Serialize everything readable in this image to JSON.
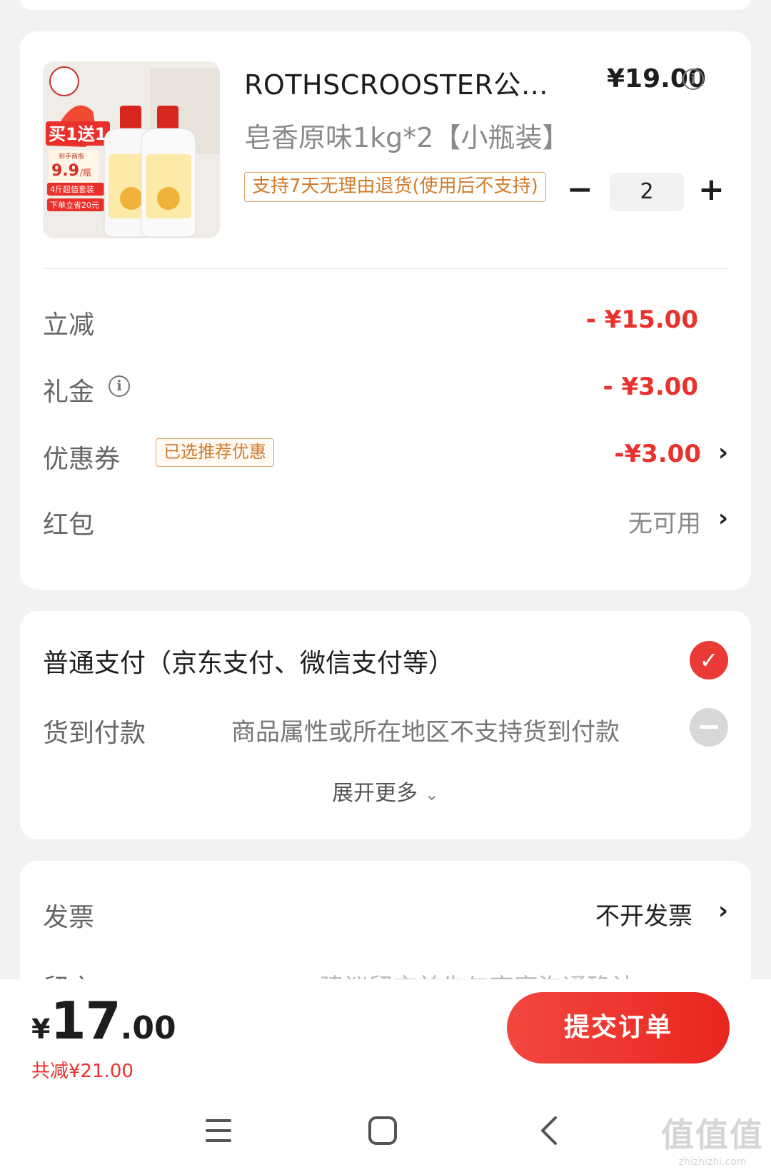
{
  "product": {
    "title": "ROTHSCROOSTER公鸡…",
    "price": "¥19.00",
    "spec": "皂香原味1kg*2【小瓶装】",
    "return_tag": "支持7天无理由退货(使用后不支持)",
    "quantity": "2",
    "image_text": {
      "promo": "买1送1",
      "sub": "到手两瓶",
      "price": "9.9",
      "unit": "/瓶",
      "line1": "4斤超值套装",
      "line2": "下单立省20元"
    }
  },
  "discounts": {
    "instant": {
      "label": "立减",
      "value": "- ¥15.00"
    },
    "gift": {
      "label": "礼金",
      "value": "- ¥3.00"
    },
    "coupon": {
      "label": "优惠券",
      "badge": "已选推荐优惠",
      "value": "-¥3.00"
    },
    "redpacket": {
      "label": "红包",
      "value": "无可用"
    }
  },
  "payment": {
    "normal_label": "普通支付（京东支付、微信支付等）",
    "cod_label": "货到付款",
    "cod_note": "商品属性或所在地区不支持货到付款",
    "expand_label": "展开更多"
  },
  "invoice": {
    "label": "发票",
    "value": "不开发票",
    "remark_label": "留言",
    "remark_hint": "建议留言前先与商家沟通确认"
  },
  "bottom": {
    "currency": "¥",
    "total_int": "17",
    "total_dec": ".00",
    "saved": "共减¥21.00",
    "submit": "提交订单"
  },
  "watermark": {
    "top": "值值值",
    "bottom": "zhizhizhi.com"
  },
  "colors": {
    "accent_red": "#e8322d",
    "tag_orange": "#d17b2b"
  }
}
